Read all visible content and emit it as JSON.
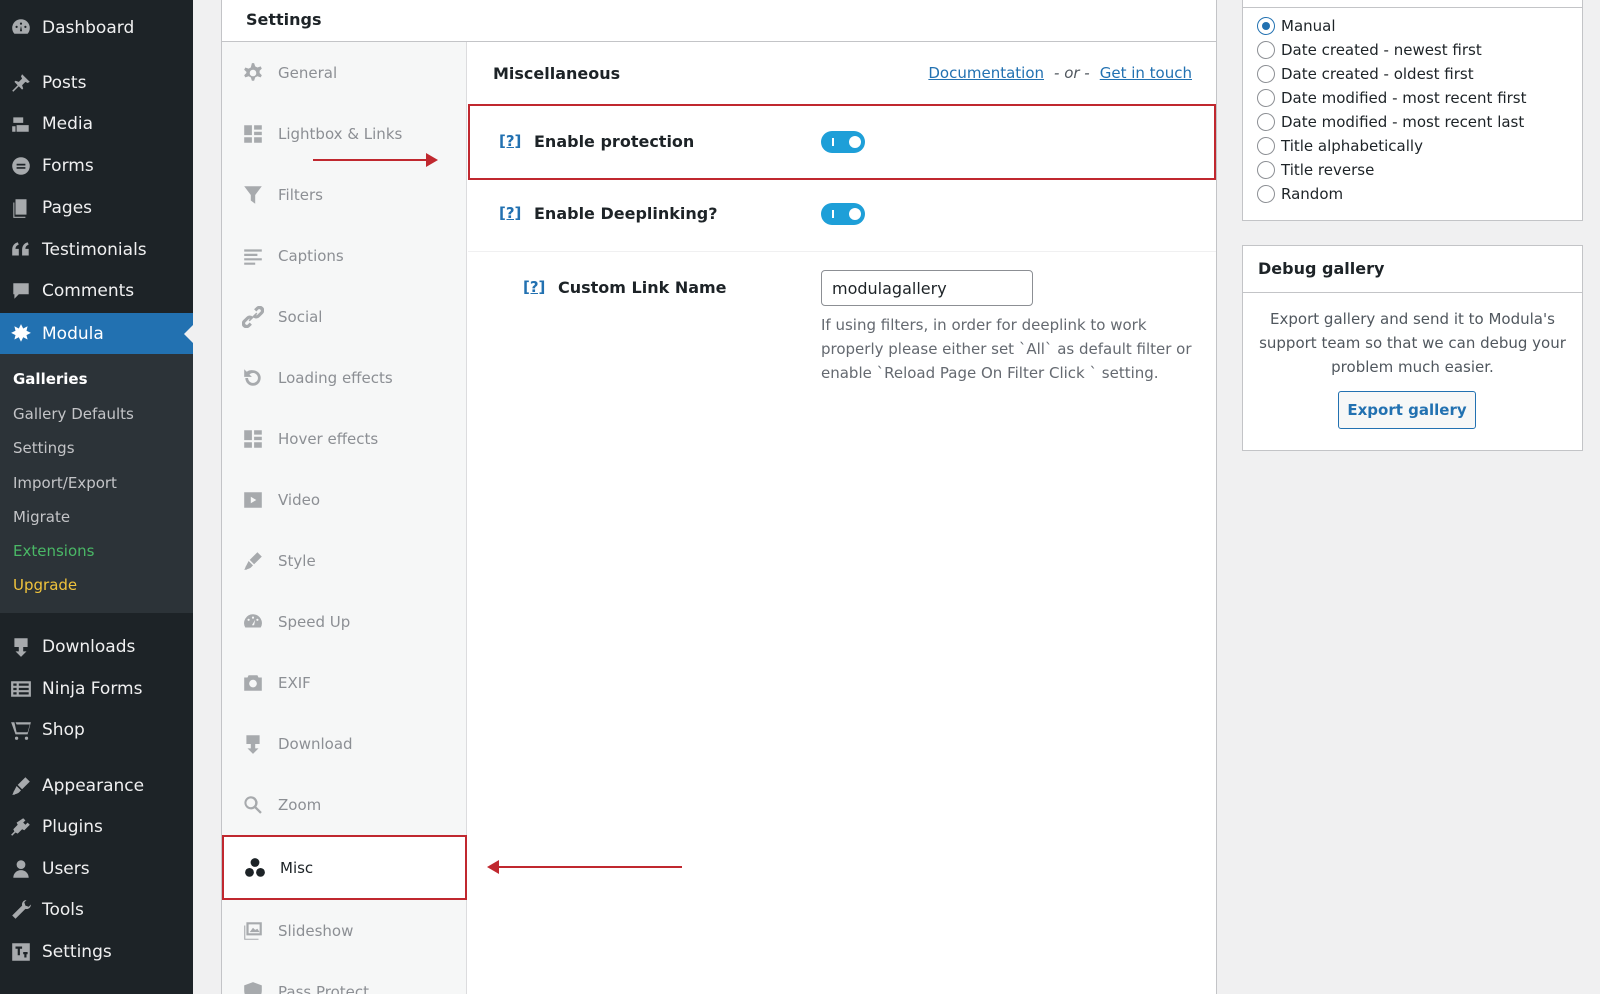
{
  "admin_menu": {
    "items": [
      {
        "label": "Dashboard",
        "icon": "dashboard-icon"
      },
      {
        "label": "Posts",
        "icon": "pin-icon"
      },
      {
        "label": "Media",
        "icon": "media-icon"
      },
      {
        "label": "Forms",
        "icon": "forms-icon"
      },
      {
        "label": "Pages",
        "icon": "pages-icon"
      },
      {
        "label": "Testimonials",
        "icon": "quote-icon"
      },
      {
        "label": "Comments",
        "icon": "comment-icon"
      },
      {
        "label": "Modula",
        "icon": "modula-icon"
      },
      {
        "label": "Downloads",
        "icon": "download-icon"
      },
      {
        "label": "Ninja Forms",
        "icon": "list-icon"
      },
      {
        "label": "Shop",
        "icon": "cart-icon"
      },
      {
        "label": "Appearance",
        "icon": "brush-icon"
      },
      {
        "label": "Plugins",
        "icon": "plugin-icon"
      },
      {
        "label": "Users",
        "icon": "user-icon"
      },
      {
        "label": "Tools",
        "icon": "wrench-icon"
      },
      {
        "label": "Settings",
        "icon": "settings-icon"
      }
    ],
    "submenu": [
      {
        "label": "Galleries"
      },
      {
        "label": "Gallery Defaults"
      },
      {
        "label": "Settings"
      },
      {
        "label": "Import/Export"
      },
      {
        "label": "Migrate"
      },
      {
        "label": "Extensions"
      },
      {
        "label": "Upgrade"
      }
    ]
  },
  "settings": {
    "title": "Settings",
    "tabs": [
      {
        "label": "General",
        "icon": "gear-icon"
      },
      {
        "label": "Lightbox & Links",
        "icon": "grid-icon"
      },
      {
        "label": "Filters",
        "icon": "filter-icon"
      },
      {
        "label": "Captions",
        "icon": "lines-icon"
      },
      {
        "label": "Social",
        "icon": "link-icon"
      },
      {
        "label": "Loading effects",
        "icon": "reload-icon"
      },
      {
        "label": "Hover effects",
        "icon": "grid-icon"
      },
      {
        "label": "Video",
        "icon": "video-icon"
      },
      {
        "label": "Style",
        "icon": "brush-icon"
      },
      {
        "label": "Speed Up",
        "icon": "gauge-icon"
      },
      {
        "label": "EXIF",
        "icon": "camera-icon"
      },
      {
        "label": "Download",
        "icon": "download-icon"
      },
      {
        "label": "Zoom",
        "icon": "search-icon"
      },
      {
        "label": "Misc",
        "icon": "circles-icon"
      },
      {
        "label": "Slideshow",
        "icon": "images-icon"
      },
      {
        "label": "Pass Protect",
        "icon": "shield-icon"
      }
    ],
    "section_title": "Miscellaneous",
    "documentation_link": "Documentation",
    "or_text": "- or -",
    "contact_link": "Get in touch",
    "help_label": "[?]",
    "enable_protection_label": "Enable protection",
    "enable_deeplinking_label": "Enable Deeplinking?",
    "custom_link_label": "Custom Link Name",
    "custom_link_value": "modulagallery",
    "custom_link_desc": "If using filters, in order for deeplink to work properly please either set `All` as default filter or enable `Reload Page On Filter Click ` setting."
  },
  "sort_options": {
    "options": [
      "Manual",
      "Date created - newest first",
      "Date created - oldest first",
      "Date modified - most recent first",
      "Date modified - most recent last",
      "Title alphabetically",
      "Title reverse",
      "Random"
    ],
    "selected": "Manual"
  },
  "debug": {
    "title": "Debug gallery",
    "text": "Export gallery and send it to Modula's support team so that we can debug your problem much easier.",
    "button": "Export gallery"
  },
  "colors": {
    "accent": "#2271b1",
    "highlight": "#c0282f",
    "toggle": "#1e9fd8",
    "sidebar": "#1d2327"
  }
}
